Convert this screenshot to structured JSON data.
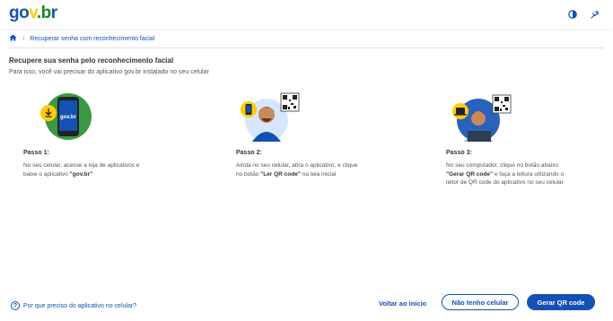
{
  "header": {
    "logo": {
      "g": "g",
      "o": "o",
      "v": "v",
      ".": ".",
      "b": "b",
      "r": "r"
    },
    "contrast_icon": "contrast-icon",
    "accessibility_icon": "accessibility-icon"
  },
  "breadcrumb": {
    "home_icon": "home-icon",
    "current": "Recuperar senha com reconhecimento facial"
  },
  "page": {
    "title": "Recupere sua senha pelo reconhecimento facial",
    "subtitle": "Para isso, você vai precisar do aplicativo gov.br instalado no seu celular"
  },
  "steps": [
    {
      "label": "Passo 1:",
      "text_a": "No seu celular, acesse a loja de aplicativos e",
      "text_b_pre": "baixe o aplicativo ",
      "text_b_bold": "\"gov.br\"",
      "phone_brand": "gov.br"
    },
    {
      "label": "Passo 2:",
      "text_a": "Ainda no seu celular, abra o aplicativo, e clique",
      "text_b_pre": "no botão ",
      "text_b_bold": "\"Ler QR code\"",
      "text_b_post": " na tela inicial"
    },
    {
      "label": "Passo 3:",
      "text_a": "No seu computador, clique no botão abaixo",
      "text_b_bold": "\"Gerar QR code\"",
      "text_b_post": " e faça a leitura utilizando o",
      "text_c": "leitor de QR code do aplicativo no seu celular"
    }
  ],
  "footer": {
    "help_link": "Por que preciso do aplicativo no celular?",
    "back_button": "Voltar ao início",
    "no_phone_button": "Não tenho celular",
    "generate_button": "Gerar QR code"
  },
  "colors": {
    "primary": "#1351b4",
    "accent_yellow": "#ffcd07",
    "accent_green": "#168821"
  }
}
